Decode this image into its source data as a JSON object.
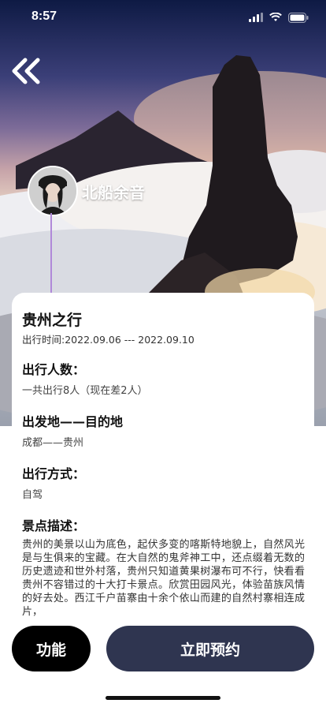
{
  "status_bar": {
    "time": "8:57"
  },
  "profile": {
    "username": "北船余音"
  },
  "trip": {
    "title": "贵州之行",
    "date": "出行时间:2022.09.06 --- 2022.09.10"
  },
  "sections": {
    "people": {
      "title": "出行人数：",
      "value": "一共出行8人（现在差2人）"
    },
    "route": {
      "title": "出发地——目的地",
      "value": "成都——贵州"
    },
    "mode": {
      "title": "出行方式：",
      "value": "自驾"
    },
    "description": {
      "title": "景点描述：",
      "text": "贵州的美景以山为底色，起伏多变的喀斯特地貌上，自然风光是与生俱来的宝藏。在大自然的鬼斧神工中，还点缀着无数的历史遗迹和世外村落，贵州只知道黄果树瀑布可不行，快看看贵州不容错过的十大打卡景点。欣赏田园风光，体验苗族风情的好去处。西江千户苗寨由十余个依山而建的自然村寨相连成片，"
    }
  },
  "actions": {
    "function_label": "功能",
    "book_label": "立即预约"
  },
  "icons": {
    "back": "double-chevron-left-icon",
    "signal": "signal-icon",
    "wifi": "wifi-icon",
    "battery": "battery-icon"
  },
  "colors": {
    "book_button": "#2f3550",
    "function_button": "#000000",
    "timeline": "#b089d9"
  }
}
